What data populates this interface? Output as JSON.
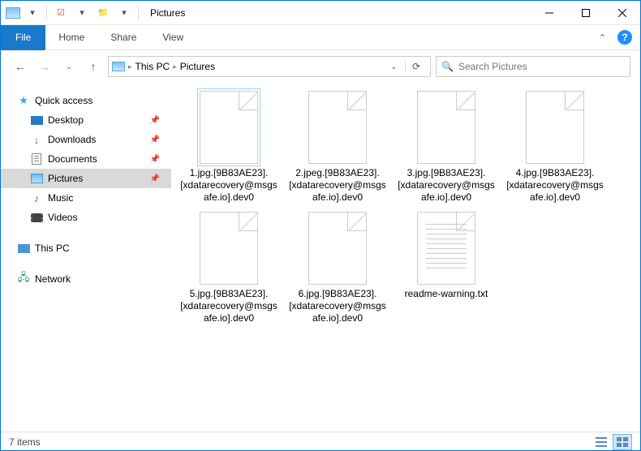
{
  "title": "Pictures",
  "ribbon": {
    "file": "File",
    "tabs": [
      "Home",
      "Share",
      "View"
    ]
  },
  "breadcrumb": {
    "root": "",
    "pc": "This PC",
    "folder": "Pictures"
  },
  "search": {
    "placeholder": "Search Pictures"
  },
  "nav": {
    "quick_access": "Quick access",
    "items": [
      {
        "label": "Desktop",
        "icon": "desktop",
        "pinned": true
      },
      {
        "label": "Downloads",
        "icon": "down",
        "pinned": true
      },
      {
        "label": "Documents",
        "icon": "doc",
        "pinned": true
      },
      {
        "label": "Pictures",
        "icon": "pic",
        "pinned": true,
        "selected": true
      },
      {
        "label": "Music",
        "icon": "music",
        "pinned": false
      },
      {
        "label": "Videos",
        "icon": "video",
        "pinned": false
      }
    ],
    "this_pc": "This PC",
    "network": "Network"
  },
  "files": [
    {
      "name": "1.jpg.[9B83AE23].[xdatarecovery@msgsafe.io].dev0",
      "type": "blank",
      "selected": true
    },
    {
      "name": "2.jpeg.[9B83AE23].[xdatarecovery@msgsafe.io].dev0",
      "type": "blank"
    },
    {
      "name": "3.jpg.[9B83AE23].[xdatarecovery@msgsafe.io].dev0",
      "type": "blank"
    },
    {
      "name": "4.jpg.[9B83AE23].[xdatarecovery@msgsafe.io].dev0",
      "type": "blank"
    },
    {
      "name": "5.jpg.[9B83AE23].[xdatarecovery@msgsafe.io].dev0",
      "type": "blank"
    },
    {
      "name": "6.jpg.[9B83AE23].[xdatarecovery@msgsafe.io].dev0",
      "type": "blank"
    },
    {
      "name": "readme-warning.txt",
      "type": "txt"
    }
  ],
  "status": {
    "count": "7 items"
  }
}
